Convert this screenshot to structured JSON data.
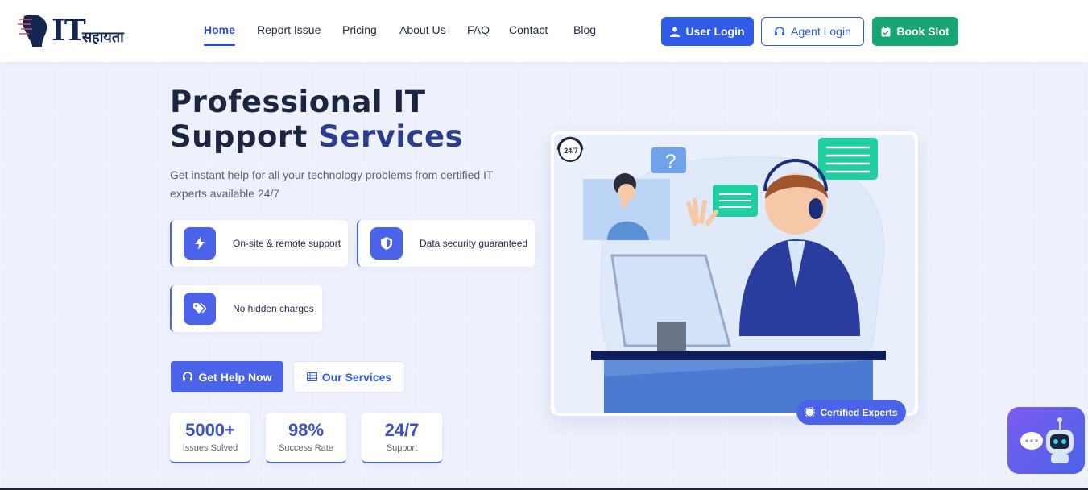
{
  "header": {
    "logo_text": "IT",
    "logo_subtext": "सहायता",
    "nav": [
      {
        "label": "Home",
        "active": true
      },
      {
        "label": "Report Issue"
      },
      {
        "label": "Pricing"
      },
      {
        "label": "About Us"
      },
      {
        "label": "FAQ"
      },
      {
        "label": "Contact"
      },
      {
        "label": "Blog"
      }
    ],
    "buttons": {
      "user_login": "User Login",
      "agent_login": "Agent Login",
      "book_slot": "Book Slot"
    }
  },
  "hero": {
    "title_line1": "Professional IT",
    "title_line2a": "Support",
    "title_line2b": "Services",
    "subtitle": "Get instant help for all your technology problems from certified IT experts available 24/7",
    "features": [
      {
        "label": "On-site & remote support",
        "icon": "bolt-icon"
      },
      {
        "label": "Data security guaranteed",
        "icon": "shield-icon"
      },
      {
        "label": "No hidden charges",
        "icon": "tag-icon"
      }
    ],
    "cta_primary": "Get Help Now",
    "cta_secondary": "Our Services",
    "stats": [
      {
        "value": "5000+",
        "label": "Issues Solved"
      },
      {
        "value": "98%",
        "label": "Success Rate"
      },
      {
        "value": "24/7",
        "label": "Support"
      }
    ]
  },
  "illustration": {
    "badge": "24/7",
    "question_mark": "?",
    "certified_label": "Certified Experts"
  },
  "colors": {
    "primary": "#2f5be6",
    "accent": "#4a63e8",
    "success": "#17a673",
    "dark": "#1c2541"
  }
}
